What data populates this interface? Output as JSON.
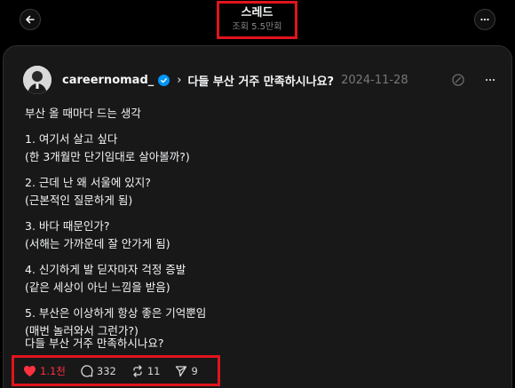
{
  "header": {
    "title": "스레드",
    "views": "조회 5.5만회"
  },
  "post": {
    "username": "careernomad_",
    "title": "다들 부산 거주 만족하시나요?",
    "date": "2024-11-28",
    "lines": [
      "부산 올 때마다 드는 생각",
      "1. 여기서 살고 싶다",
      "(한 3개월만 단기임대로 살아볼까?)",
      "2. 근데 난 왜 서울에 있지?",
      "(근본적인 질문하게 됨)",
      "3. 바다 때문인가?",
      "(서해는 가까운데 잘 안가게 됨)",
      "4. 신기하게 발 딛자마자 걱정 증발",
      "(같은 세상이 아닌 느낌을 받음)",
      "5. 부산은 이상하게 항상 좋은 기억뿐임",
      "(매번 놀러와서 그런가?)"
    ],
    "closing": "다들 부산 거주 만족하시나요?"
  },
  "actions": {
    "likes": "1.1천",
    "comments": "332",
    "reposts": "11",
    "shares": "9"
  },
  "icons": {
    "back": "arrow-left-icon",
    "more": "more-horizontal-icon",
    "verified": "verified-badge-icon",
    "quote": "quote-icon",
    "like": "heart-icon",
    "comment": "comment-icon",
    "repost": "repost-icon",
    "share": "send-icon"
  },
  "colors": {
    "like_active": "#ff3040",
    "verified": "#0095f6",
    "highlight_box": "#e0141e"
  }
}
